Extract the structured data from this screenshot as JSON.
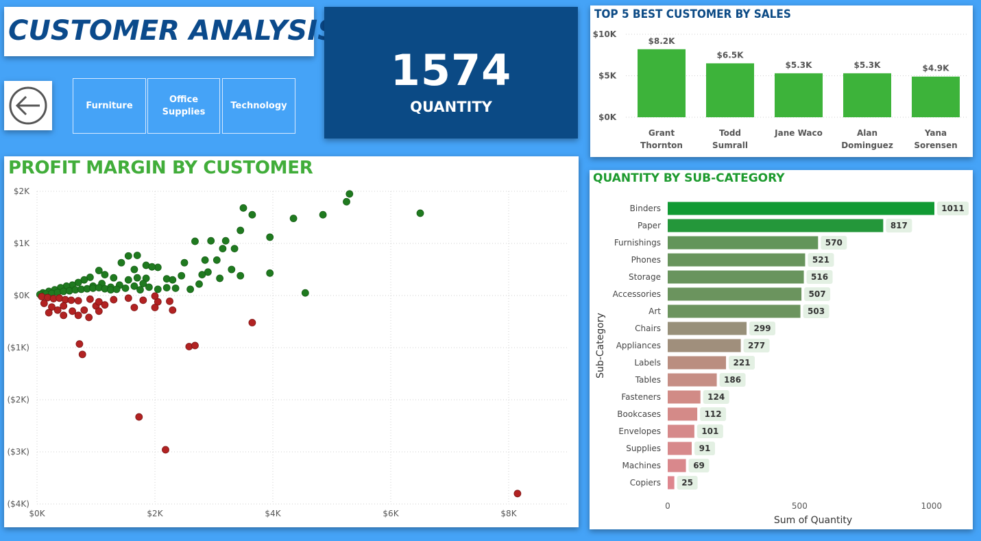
{
  "page_title": "CUSTOMER ANALYSIS",
  "category_buttons": [
    "Furniture",
    "Office Supplies",
    "Technology"
  ],
  "back_icon": "left-arrow-circle-icon",
  "kpi": {
    "value": "1574",
    "label": "QUANTITY"
  },
  "colors": {
    "brand_blue": "#0b4a85",
    "background": "#45a3f7",
    "profit_green": "#1f7a1f",
    "loss_red": "#b22222",
    "bar_green": "#3db33a"
  },
  "top5": {
    "title": "TOP 5 BEST CUSTOMER BY SALES",
    "chart_data": {
      "type": "bar",
      "categories": [
        [
          "Grant",
          "Thornton"
        ],
        [
          "Todd",
          "Sumrall"
        ],
        [
          "Jane Waco"
        ],
        [
          "Alan",
          "Dominguez"
        ],
        [
          "Yana",
          "Sorensen"
        ]
      ],
      "values": [
        8200,
        6500,
        5300,
        5300,
        4900
      ],
      "data_labels": [
        "$8.2K",
        "$6.5K",
        "$5.3K",
        "$5.3K",
        "$4.9K"
      ],
      "ylim": [
        0,
        10000
      ],
      "yticks": [
        10000,
        5000,
        0
      ],
      "ytick_labels": [
        "$10K",
        "$5K",
        "$0K"
      ]
    }
  },
  "scatter": {
    "title": "PROFIT MARGIN BY CUSTOMER",
    "chart_data": {
      "type": "scatter",
      "xlim": [
        0,
        9000
      ],
      "ylim": [
        -4000,
        2000
      ],
      "xticks": [
        0,
        2000,
        4000,
        6000,
        8000
      ],
      "xtick_labels": [
        "$0K",
        "$2K",
        "$4K",
        "$6K",
        "$8K"
      ],
      "yticks": [
        2000,
        1000,
        0,
        -1000,
        -2000,
        -3000,
        -4000
      ],
      "ytick_labels": [
        "$2K",
        "$1K",
        "$0K",
        "($1K)",
        "($2K)",
        "($3K)",
        "($4K)"
      ],
      "points": [
        [
          5300,
          1950
        ],
        [
          5250,
          1800
        ],
        [
          6500,
          1580
        ],
        [
          3500,
          1680
        ],
        [
          3650,
          1550
        ],
        [
          4350,
          1480
        ],
        [
          4850,
          1550
        ],
        [
          3450,
          1250
        ],
        [
          3950,
          1120
        ],
        [
          2680,
          1040
        ],
        [
          2950,
          1050
        ],
        [
          3200,
          1050
        ],
        [
          3150,
          900
        ],
        [
          3350,
          900
        ],
        [
          1550,
          760
        ],
        [
          1700,
          770
        ],
        [
          2500,
          630
        ],
        [
          2850,
          680
        ],
        [
          3050,
          680
        ],
        [
          3300,
          500
        ],
        [
          1430,
          630
        ],
        [
          1850,
          580
        ],
        [
          2050,
          540
        ],
        [
          1950,
          550
        ],
        [
          2900,
          450
        ],
        [
          3950,
          430
        ],
        [
          3450,
          380
        ],
        [
          3100,
          330
        ],
        [
          2800,
          400
        ],
        [
          2750,
          220
        ],
        [
          2450,
          380
        ],
        [
          2200,
          320
        ],
        [
          2300,
          300
        ],
        [
          1850,
          330
        ],
        [
          1650,
          500
        ],
        [
          1700,
          340
        ],
        [
          1800,
          230
        ],
        [
          1550,
          300
        ],
        [
          1300,
          340
        ],
        [
          1150,
          400
        ],
        [
          1050,
          480
        ],
        [
          900,
          350
        ],
        [
          800,
          300
        ],
        [
          700,
          250
        ],
        [
          600,
          200
        ],
        [
          500,
          180
        ],
        [
          400,
          150
        ],
        [
          300,
          110
        ],
        [
          200,
          80
        ],
        [
          100,
          50
        ],
        [
          950,
          180
        ],
        [
          1100,
          230
        ],
        [
          1250,
          160
        ],
        [
          1400,
          200
        ],
        [
          1500,
          140
        ],
        [
          1650,
          180
        ],
        [
          1750,
          110
        ],
        [
          1900,
          160
        ],
        [
          2050,
          120
        ],
        [
          2200,
          150
        ],
        [
          2350,
          140
        ],
        [
          2600,
          120
        ],
        [
          4550,
          50
        ],
        [
          50,
          20
        ],
        [
          150,
          30
        ],
        [
          250,
          40
        ],
        [
          350,
          60
        ],
        [
          450,
          80
        ],
        [
          550,
          90
        ],
        [
          650,
          110
        ],
        [
          750,
          120
        ],
        [
          850,
          130
        ],
        [
          950,
          140
        ],
        [
          1050,
          150
        ],
        [
          1150,
          130
        ],
        [
          1250,
          110
        ],
        [
          1350,
          120
        ],
        [
          80,
          -20
        ],
        [
          180,
          -40
        ],
        [
          280,
          -60
        ],
        [
          380,
          -50
        ],
        [
          480,
          -80
        ],
        [
          580,
          -90
        ],
        [
          700,
          -100
        ],
        [
          120,
          -150
        ],
        [
          250,
          -220
        ],
        [
          350,
          -280
        ],
        [
          450,
          -200
        ],
        [
          600,
          -300
        ],
        [
          800,
          -280
        ],
        [
          1000,
          -200
        ],
        [
          1300,
          -80
        ],
        [
          1550,
          -50
        ],
        [
          2050,
          -120
        ],
        [
          2300,
          -280
        ],
        [
          2000,
          -10
        ],
        [
          1800,
          -90
        ],
        [
          1050,
          -120
        ],
        [
          900,
          -70
        ],
        [
          700,
          -380
        ],
        [
          880,
          -420
        ],
        [
          1050,
          -300
        ],
        [
          1150,
          -180
        ],
        [
          200,
          -330
        ],
        [
          450,
          -380
        ],
        [
          1650,
          -230
        ],
        [
          2000,
          -230
        ],
        [
          2250,
          -110
        ],
        [
          3650,
          -520
        ],
        [
          720,
          -930
        ],
        [
          770,
          -1130
        ],
        [
          2580,
          -980
        ],
        [
          2680,
          -960
        ],
        [
          1730,
          -2330
        ],
        [
          2180,
          -2960
        ],
        [
          8150,
          -3800
        ]
      ]
    }
  },
  "subcategory": {
    "title": "QUANTITY BY SUB-CATEGORY",
    "chart_data": {
      "type": "bar",
      "orientation": "horizontal",
      "categories": [
        "Binders",
        "Paper",
        "Furnishings",
        "Phones",
        "Storage",
        "Accessories",
        "Art",
        "Chairs",
        "Appliances",
        "Labels",
        "Tables",
        "Fasteners",
        "Bookcases",
        "Envelopes",
        "Supplies",
        "Machines",
        "Copiers"
      ],
      "values": [
        1011,
        817,
        570,
        521,
        516,
        507,
        503,
        299,
        277,
        221,
        186,
        124,
        112,
        101,
        91,
        69,
        25
      ],
      "colors": [
        "#119a33",
        "#24973a",
        "#63955a",
        "#68945c",
        "#69945d",
        "#6b945e",
        "#6c945e",
        "#98907a",
        "#a08f7c",
        "#ba8e80",
        "#c68e85",
        "#d18b86",
        "#d48a88",
        "#d6898a",
        "#d7898b",
        "#d9888c",
        "#de868e"
      ],
      "xlim": [
        0,
        1100
      ],
      "xticks": [
        0,
        500,
        1000
      ],
      "xtick_labels": [
        "0",
        "500",
        "1000"
      ],
      "xlabel": "Sum of Quantity",
      "ylabel": "Sub-Category"
    }
  }
}
